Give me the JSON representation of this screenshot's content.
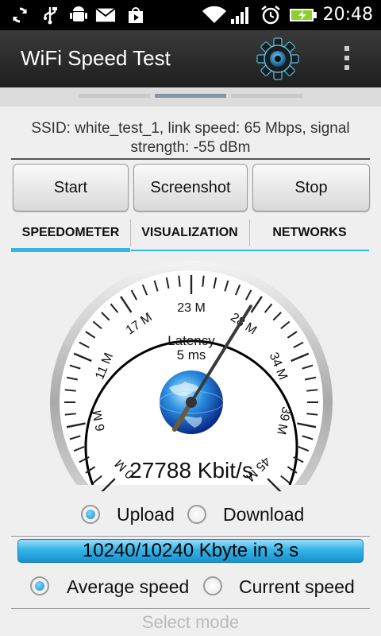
{
  "status_bar": {
    "time": "20:48",
    "icons": [
      "sync-icon",
      "usb-icon",
      "android-debug-icon",
      "mail-icon",
      "play-store-icon",
      "wifi-icon",
      "signal-icon",
      "alarm-icon",
      "battery-charging-icon"
    ]
  },
  "app_bar": {
    "title": "WiFi Speed Test",
    "settings_icon": "gear-icon",
    "menu_icon": "overflow-menu-icon"
  },
  "pager": {
    "count": 3,
    "active_index": 1
  },
  "connection_info": "SSID: white_test_1, link speed: 65 Mbps, signal strength: -55 dBm",
  "buttons": {
    "start": "Start",
    "screenshot": "Screenshot",
    "stop": "Stop"
  },
  "tabs": [
    {
      "label": "SPEEDOMETER",
      "active": true
    },
    {
      "label": "VISUALIZATION",
      "active": false
    },
    {
      "label": "NETWORKS",
      "active": false
    }
  ],
  "gauge": {
    "scale_labels": [
      "0 M",
      "6 M",
      "11 M",
      "17 M",
      "23 M",
      "28 M",
      "34 M",
      "39 M",
      "45 M"
    ],
    "latency_label": "Latency",
    "latency_value": "5 ms",
    "speed_readout": "27788 Kbit/s",
    "needle_value_mbit": 27.8,
    "max_mbit": 45,
    "center_icon": "globe-icon"
  },
  "direction": {
    "upload": "Upload",
    "download": "Download",
    "selected": "upload"
  },
  "progress_text": "10240/10240 Kbyte in 3 s",
  "progress_fraction": 1.0,
  "speed_mode": {
    "average": "Average speed",
    "current": "Current speed",
    "selected": "average"
  },
  "select_mode_label": "Select mode",
  "colors": {
    "accent": "#33b5e5",
    "appbar": "#2b2b2b"
  }
}
